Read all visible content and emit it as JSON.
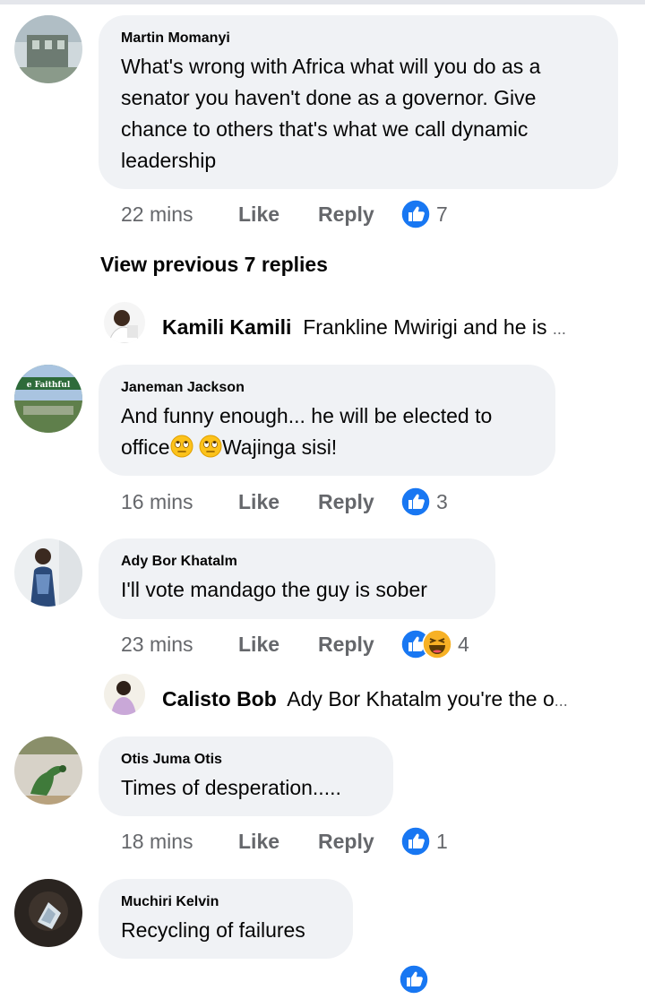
{
  "comments": [
    {
      "author": "Martin Momanyi",
      "text": "What's wrong with Africa what will you do as a senator you haven't done as a governor. Give chance to others that's what we call dynamic leadership",
      "time": "22 mins",
      "like": "Like",
      "reply": "Reply",
      "reactions": "7"
    },
    {
      "author": "Janeman Jackson",
      "text_part1": "And funny enough... he will be elected to office",
      "text_part2": "Wajinga sisi!",
      "time": "16 mins",
      "like": "Like",
      "reply": "Reply",
      "reactions": "3"
    },
    {
      "author": "Ady Bor Khatalm",
      "text": "I'll vote mandago the guy is sober",
      "time": "23 mins",
      "like": "Like",
      "reply": "Reply",
      "reactions": "4"
    },
    {
      "author": "Otis Juma Otis",
      "text": "Times of desperation.....",
      "time": "18 mins",
      "like": "Like",
      "reply": "Reply",
      "reactions": "1"
    },
    {
      "author": "Muchiri Kelvin",
      "text": "Recycling of failures"
    }
  ],
  "view_previous": "View previous 7 replies",
  "reply_previews": [
    {
      "name": "Kamili Kamili",
      "text": "Frankline Mwirigi and he is",
      "ellipsis": "..."
    },
    {
      "name": "Calisto Bob",
      "text": "Ady Bor Khatalm you're the o",
      "ellipsis": "..."
    }
  ],
  "colors": {
    "like_blue": "#1877f2",
    "bubble": "#f0f2f5",
    "meta_gray": "#65676b"
  },
  "icons": [
    "like-thumb-icon",
    "haha-emoji-icon",
    "rolling-eyes-emoji-icon"
  ]
}
